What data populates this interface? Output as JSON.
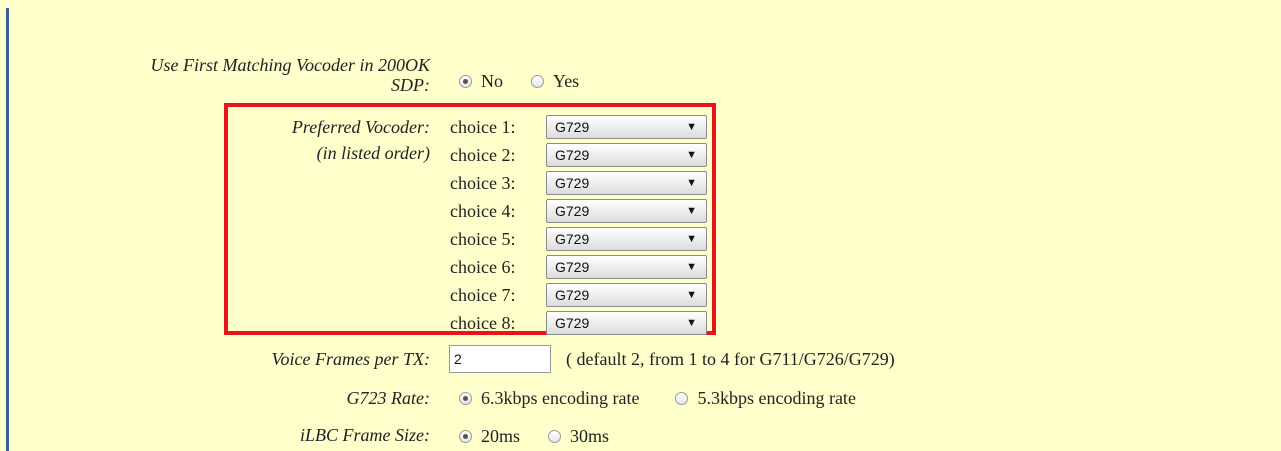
{
  "vocoder_200ok": {
    "label_line1": "Use First Matching Vocoder in 200OK",
    "label_line2": "SDP:",
    "options": [
      "No",
      "Yes"
    ],
    "selected": "No"
  },
  "preferred_vocoder": {
    "label_line1": "Preferred Vocoder:",
    "label_line2": "(in listed order)",
    "choices": [
      {
        "label": "choice 1:",
        "value": "G729"
      },
      {
        "label": "choice 2:",
        "value": "G729"
      },
      {
        "label": "choice 3:",
        "value": "G729"
      },
      {
        "label": "choice 4:",
        "value": "G729"
      },
      {
        "label": "choice 5:",
        "value": "G729"
      },
      {
        "label": "choice 6:",
        "value": "G729"
      },
      {
        "label": "choice 7:",
        "value": "G729"
      },
      {
        "label": "choice 8:",
        "value": "G729"
      }
    ],
    "dropdown_arrow": "▼",
    "highlight_color": "#e8141b"
  },
  "voice_frames": {
    "label": "Voice Frames per TX:",
    "value": "2",
    "hint": "( default 2, from 1 to 4 for G711/G726/G729)"
  },
  "g723_rate": {
    "label": "G723 Rate:",
    "options": [
      "6.3kbps encoding rate",
      "5.3kbps encoding rate"
    ],
    "selected": "6.3kbps encoding rate"
  },
  "ilbc_frame_size": {
    "label": "iLBC Frame Size:",
    "options": [
      "20ms",
      "30ms"
    ],
    "selected": "20ms"
  },
  "colors": {
    "panel_background": "#ffffcc",
    "left_border": "#3b5f8f"
  }
}
